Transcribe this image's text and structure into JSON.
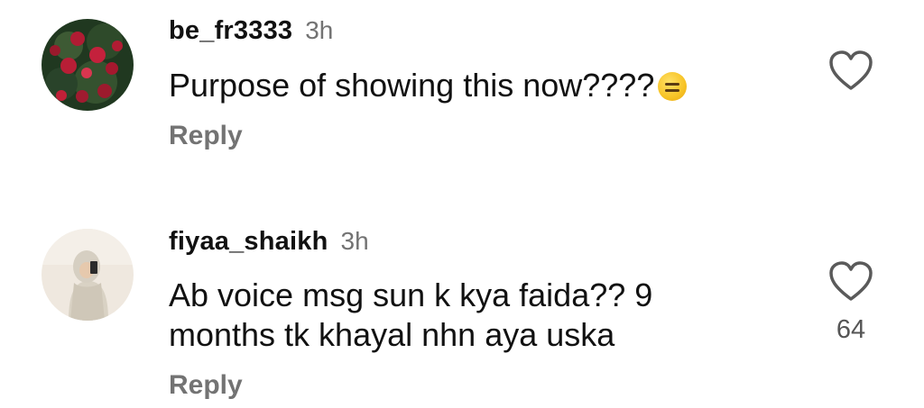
{
  "comments": [
    {
      "username": "be_fr3333",
      "time": "3h",
      "text": "Purpose of showing this now????",
      "emoji": "expressionless-face-emoji",
      "reply_label": "Reply",
      "like_icon": "heart-outline-icon",
      "like_count": ""
    },
    {
      "username": "fiyaa_shaikh",
      "time": "3h",
      "text_line1": "Ab voice msg sun k kya faida?? 9",
      "text_line2": "months tk khayal nhn aya uska",
      "reply_label": "Reply",
      "like_icon": "heart-outline-icon",
      "like_count": "64"
    }
  ],
  "colors": {
    "text": "#111111",
    "muted": "#737373",
    "background": "#ffffff"
  }
}
